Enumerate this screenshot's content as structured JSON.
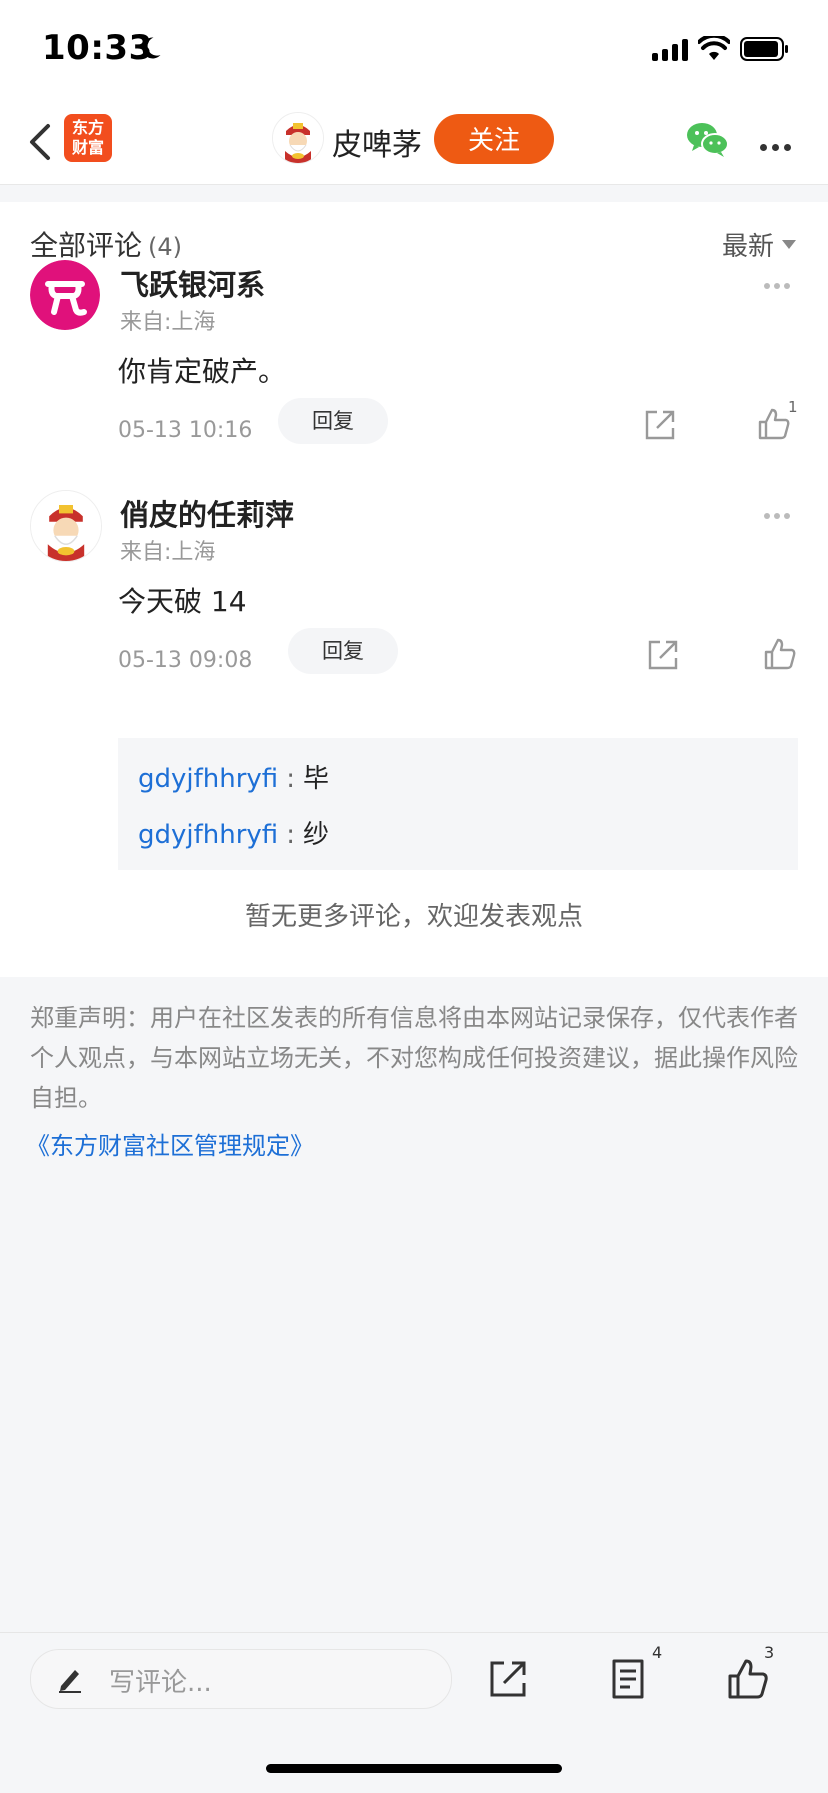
{
  "status_bar": {
    "time": "10:33"
  },
  "navbar": {
    "logo_line1": "东方",
    "logo_line2": "财富",
    "author_name": "皮啤茅",
    "follow_label": "关注"
  },
  "comments_header": {
    "title": "全部评论",
    "count": "(4)",
    "sort_label": "最新"
  },
  "comments": [
    {
      "name": "飞跃银河系",
      "location": "来自:上海",
      "text": "你肯定破产。",
      "time": "05-13 10:16",
      "reply_label": "回复",
      "likes": "1"
    },
    {
      "name": "俏皮的任莉萍",
      "location": "来自:上海",
      "text": "今天破 14",
      "time": "05-13 09:08",
      "reply_label": "回复",
      "likes": ""
    }
  ],
  "replies": [
    {
      "user": "gdyjfhhryfi",
      "sep": ":",
      "text": "毕"
    },
    {
      "user": "gdyjfhhryfi",
      "sep": ":",
      "text": "纱"
    }
  ],
  "no_more_text": "暂无更多评论，欢迎发表观点",
  "disclaimer": "郑重声明：用户在社区发表的所有信息将由本网站记录保存，仅代表作者个人观点，与本网站立场无关，不对您构成任何投资建议，据此操作风险自担。",
  "rules_link": "《东方财富社区管理规定》",
  "bottom_bar": {
    "placeholder": "写评论...",
    "comment_count": "4",
    "like_count": "3"
  },
  "colors": {
    "accent": "#ee5a13",
    "link": "#1d6fd6",
    "logo": "#f24e1e",
    "avatar1": "#e0117b"
  }
}
